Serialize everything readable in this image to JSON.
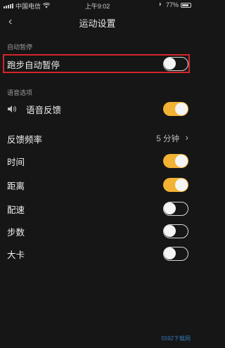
{
  "status_bar": {
    "carrier": "中国电信",
    "time": "上午9:02",
    "battery": "77%"
  },
  "nav": {
    "title": "运动设置"
  },
  "sections": {
    "auto_pause": "自动暂停",
    "voice": "语音选项"
  },
  "rows": {
    "auto_pause": {
      "label": "跑步自动暂停",
      "on": false
    },
    "voice_feedback": {
      "label": "语音反馈",
      "on": true
    },
    "frequency": {
      "label": "反馈频率",
      "value": "5 分钟"
    },
    "time": {
      "label": "时间",
      "on": true
    },
    "distance": {
      "label": "距离",
      "on": true
    },
    "pace": {
      "label": "配速",
      "on": false
    },
    "steps": {
      "label": "步数",
      "on": false
    },
    "calories": {
      "label": "大卡",
      "on": false
    }
  },
  "watermark": "5592下载网",
  "colors": {
    "accent": "#f2b233",
    "background": "#161616",
    "highlight": "#d4252b"
  }
}
